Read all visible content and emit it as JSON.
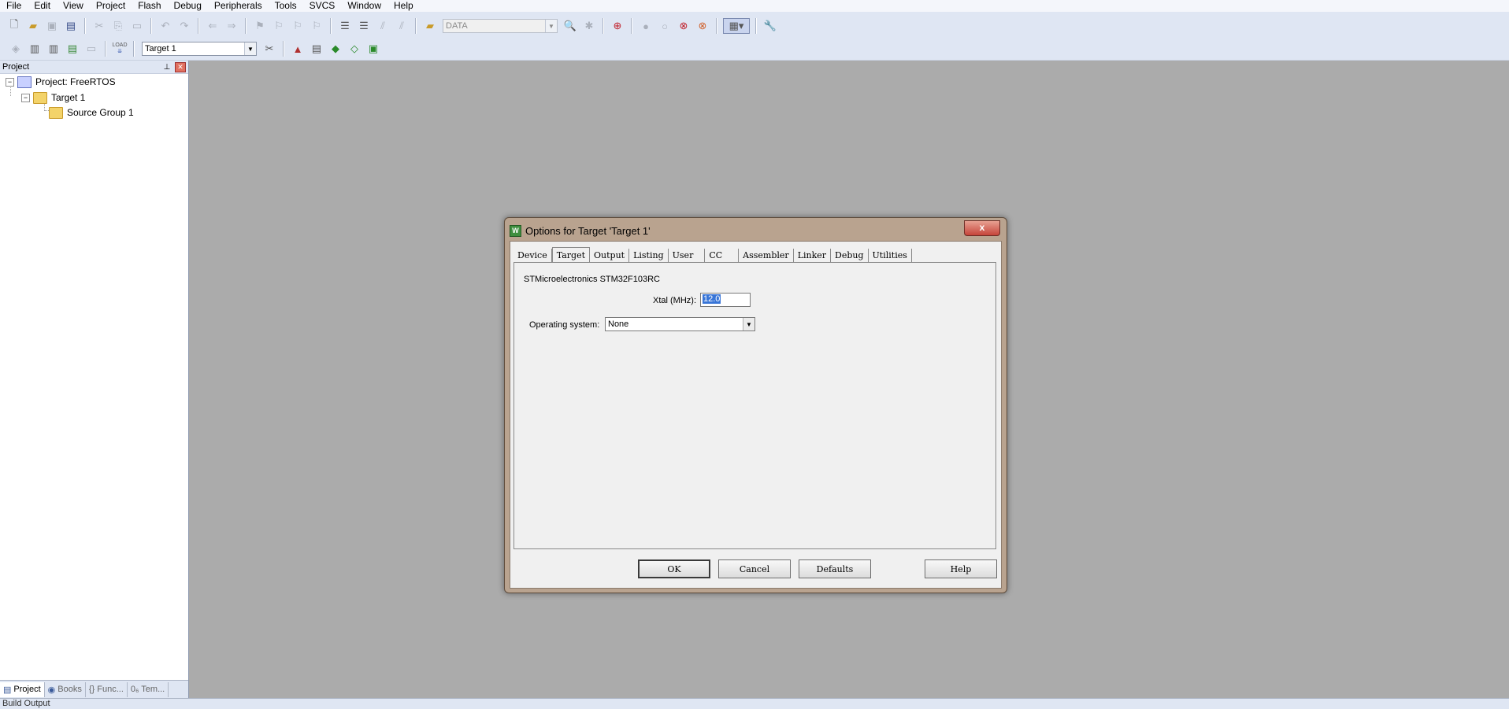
{
  "menu": [
    "File",
    "Edit",
    "View",
    "Project",
    "Flash",
    "Debug",
    "Peripherals",
    "Tools",
    "SVCS",
    "Window",
    "Help"
  ],
  "toolbar1": {
    "find_combo_value": "DATA"
  },
  "toolbar2": {
    "load_label": "LOAD",
    "target_combo_value": "Target 1"
  },
  "project_panel": {
    "title": "Project",
    "pin": "📌",
    "close": "✕",
    "tree": {
      "root": "Project: FreeRTOS",
      "target": "Target 1",
      "group": "Source Group 1"
    },
    "tabs": [
      "Project",
      "Books",
      "{} Func...",
      "0₆ Tem..."
    ]
  },
  "bottom": {
    "label": "Build Output"
  },
  "dialog": {
    "title": "Options for Target 'Target 1'",
    "close": "x",
    "tabs": [
      "Device",
      "Target",
      "Output",
      "Listing",
      "User",
      "CC",
      "Assembler",
      "Linker",
      "Debug",
      "Utilities"
    ],
    "active_tab": "Target",
    "device_name": "STMicroelectronics STM32F103RC",
    "xtal_label": "Xtal (MHz):",
    "xtal_value": "12.0",
    "os_label": "Operating system:",
    "os_value": "None",
    "buttons": {
      "ok": "OK",
      "cancel": "Cancel",
      "defaults": "Defaults",
      "help": "Help"
    }
  }
}
